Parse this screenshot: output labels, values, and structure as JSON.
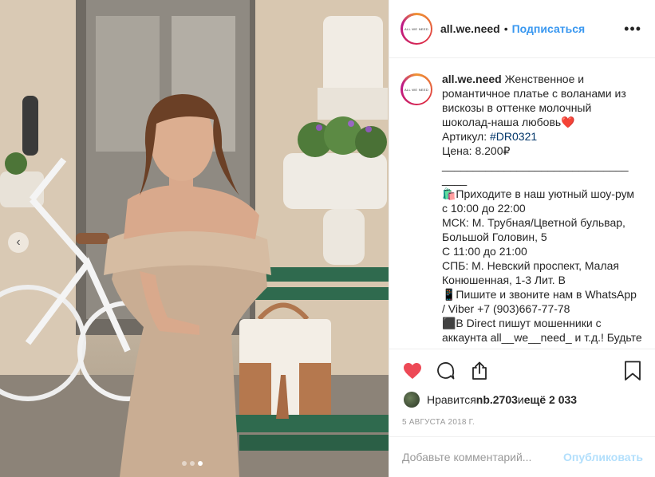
{
  "post": {
    "image_alt": "Woman in off-shoulder ruffled dress sitting on a bench with bicycle and handbag",
    "carousel": {
      "current": 3,
      "total": 3
    }
  },
  "header": {
    "username": "all.we.need",
    "separator": "•",
    "follow_label": "Подписаться",
    "more_label": "•••",
    "avatar_text": "ALL WE NEED"
  },
  "caption": {
    "username": "all.we.need",
    "lines": [
      "Женственное и",
      "романтичное платье с воланами из",
      "вискозы в оттенке молочный",
      "шоколад-наша любовь❤️",
      "Артикул: ",
      "Цена: 8.200₽",
      "______________________________",
      "____",
      "🛍️Приходите в наш уютный шоу-рум",
      "с 10:00 до 22:00",
      "МСК: М. Трубная/Цветной бульвар,",
      "Большой Головин, 5",
      "С 11:00 до 21:00",
      "СПБ: М. Невский проспект, Малая",
      "Конюшенная, 1-3 Лит. В",
      "📱Пишите и звоните нам в WhatsApp",
      "/ Viber +7 (903)667-77-78",
      "⬛В Direct пишут мошенники с",
      "аккаунта all__we__need_ и т.д.! Будьте"
    ],
    "hashtag": "#DR0321"
  },
  "actions": {
    "like_icon": "heart-filled-icon",
    "comment_icon": "comment-icon",
    "share_icon": "share-icon",
    "save_icon": "bookmark-icon"
  },
  "likes": {
    "prefix": "Нравится ",
    "user": "nb.2703",
    "and": " и ",
    "others": "ещё 2 033"
  },
  "date": "5 августа 2018 г.",
  "comment": {
    "placeholder": "Добавьте комментарий...",
    "post_label": "Опубликовать"
  },
  "colors": {
    "accent": "#3897f0",
    "like_red": "#ed4956",
    "hashtag": "#003569",
    "post_disabled": "#b2dffc"
  }
}
